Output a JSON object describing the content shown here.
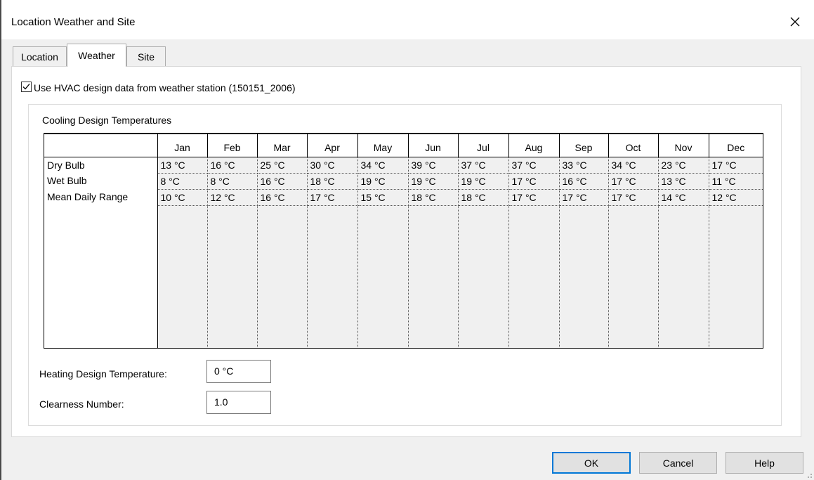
{
  "window": {
    "title": "Location Weather and Site",
    "close_glyph": "✕"
  },
  "tabs": [
    {
      "label": "Location",
      "active": false
    },
    {
      "label": "Weather",
      "active": true
    },
    {
      "label": "Site",
      "active": false
    }
  ],
  "weather": {
    "use_hvac_checked": true,
    "use_hvac_label": "Use HVAC design data from weather station (150151_2006)",
    "cooling": {
      "title": "Cooling Design Temperatures",
      "months": [
        "Jan",
        "Feb",
        "Mar",
        "Apr",
        "May",
        "Jun",
        "Jul",
        "Aug",
        "Sep",
        "Oct",
        "Nov",
        "Dec"
      ],
      "rows": [
        {
          "label": "Dry Bulb",
          "values": [
            "13 °C",
            "16 °C",
            "25 °C",
            "30 °C",
            "34 °C",
            "39 °C",
            "37 °C",
            "37 °C",
            "33 °C",
            "34 °C",
            "23 °C",
            "17 °C"
          ]
        },
        {
          "label": "Wet Bulb",
          "values": [
            "8 °C",
            "8 °C",
            "16 °C",
            "18 °C",
            "19 °C",
            "19 °C",
            "19 °C",
            "17 °C",
            "16 °C",
            "17 °C",
            "13 °C",
            "11 °C"
          ]
        },
        {
          "label": "Mean Daily Range",
          "values": [
            "10 °C",
            "12 °C",
            "16 °C",
            "17 °C",
            "15 °C",
            "18 °C",
            "18 °C",
            "17 °C",
            "17 °C",
            "17 °C",
            "14 °C",
            "12 °C"
          ]
        }
      ]
    },
    "heating_label": "Heating Design Temperature:",
    "heating_value": "0 °C",
    "clearness_label": "Clearness Number:",
    "clearness_value": "1.0"
  },
  "buttons": {
    "ok": "OK",
    "cancel": "Cancel",
    "help": "Help"
  },
  "colors": {
    "default_button_border": "#0078d7",
    "window_bg": "#f0f0f0"
  }
}
